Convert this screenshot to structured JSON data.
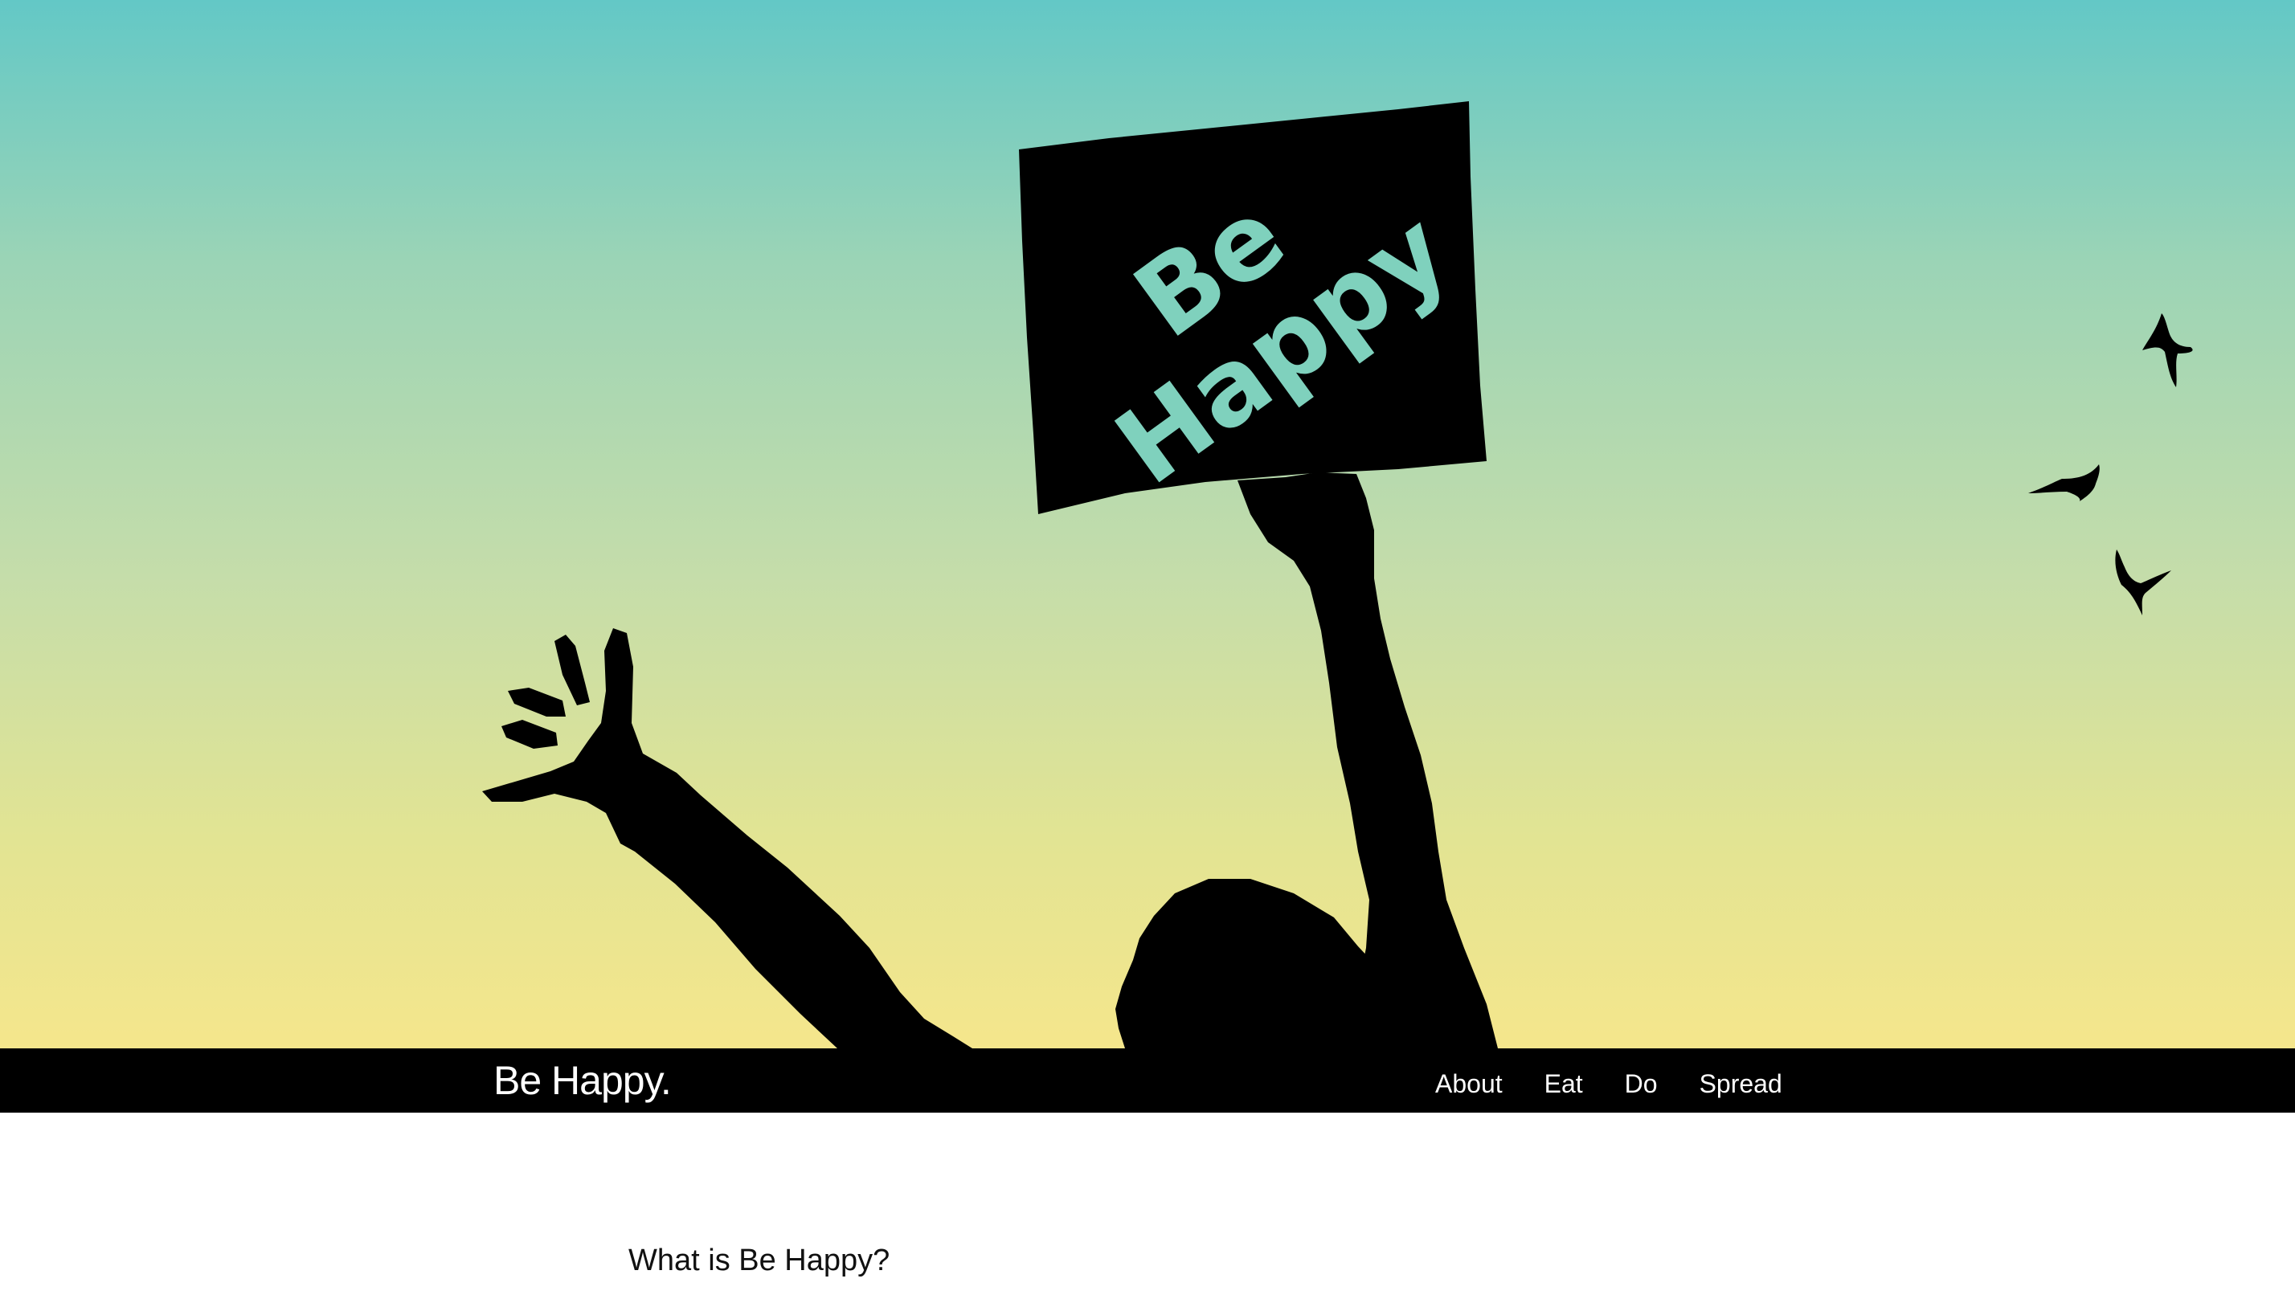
{
  "hero": {
    "sign_text": "Be Happy",
    "sky_top_color": "#63c8c6",
    "sky_bottom_color": "#f5e68c",
    "silhouette_color": "#000000",
    "sign_letter_color": "#7fd1bd"
  },
  "navbar": {
    "brand": "Be Happy.",
    "links": [
      "About",
      "Eat",
      "Do",
      "Spread"
    ]
  },
  "main": {
    "heading": "What is Be Happy?"
  }
}
